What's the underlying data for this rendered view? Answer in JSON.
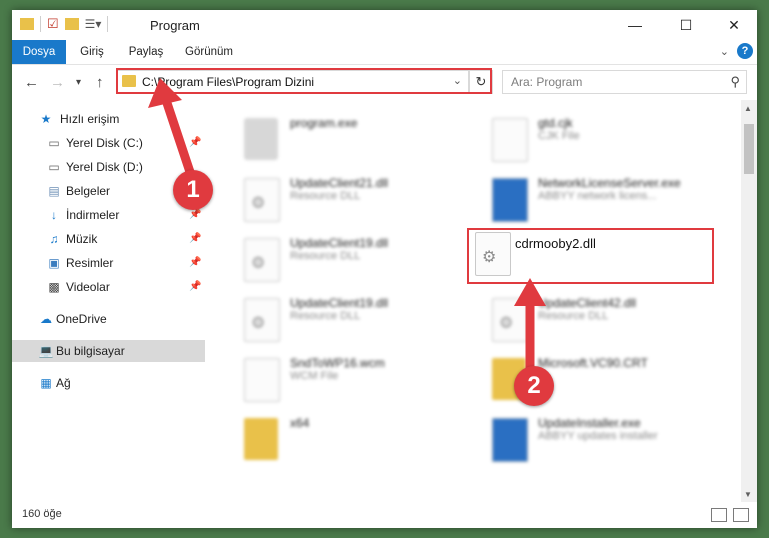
{
  "window": {
    "title": "Program",
    "controls": [
      "minimize-icon",
      "maximize-icon",
      "close-icon"
    ]
  },
  "ribbon": {
    "tabs": [
      "Dosya",
      "Giriş",
      "Paylaş",
      "Görünüm"
    ],
    "accent": "#1979ca"
  },
  "address": {
    "path": "C:\\Program Files\\Program Dizini",
    "search_placeholder": "Ara: Program"
  },
  "sidebar": {
    "items": [
      {
        "label": "Hızlı erişim",
        "icon": "star-icon"
      },
      {
        "label": "Yerel Disk (C:)",
        "icon": "drive-icon"
      },
      {
        "label": "Yerel Disk (D:)",
        "icon": "drive-icon"
      },
      {
        "label": "Belgeler",
        "icon": "documents-icon"
      },
      {
        "label": "İndirmeler",
        "icon": "download-icon"
      },
      {
        "label": "Müzik",
        "icon": "music-icon"
      },
      {
        "label": "Resimler",
        "icon": "pictures-icon"
      },
      {
        "label": "Videolar",
        "icon": "video-icon"
      },
      {
        "label": "OneDrive",
        "icon": "cloud-icon"
      },
      {
        "label": "Bu bilgisayar",
        "icon": "computer-icon"
      },
      {
        "label": "Ağ",
        "icon": "network-icon"
      }
    ]
  },
  "files": {
    "items": [
      {
        "name": "program.exe",
        "type": ""
      },
      {
        "name": "gtd.cjk",
        "type": "CJK File"
      },
      {
        "name": "UpdateClient21.dll",
        "type": "Resource DLL"
      },
      {
        "name": "NetworkLicenseServer.exe",
        "type": "ABBYY network licens..."
      },
      {
        "name": "UpdateClient19.dll",
        "type": "Resource DLL"
      },
      {
        "name": "UpdateClient19.dll",
        "type": "Resource DLL"
      },
      {
        "name": "UpdateClient42.dll",
        "type": "Resource DLL"
      },
      {
        "name": "SndToWP16.wcm",
        "type": "WCM File"
      },
      {
        "name": "Microsoft.VC90.CRT",
        "type": ""
      },
      {
        "name": "x64",
        "type": ""
      },
      {
        "name": "UpdateInstaller.exe",
        "type": "ABBYY updates installer"
      }
    ],
    "highlighted": "cdrmooby2.dll"
  },
  "status": {
    "count": "160 öğe"
  },
  "annotations": {
    "step1": "1",
    "step2": "2",
    "color": "#e03a3f"
  }
}
